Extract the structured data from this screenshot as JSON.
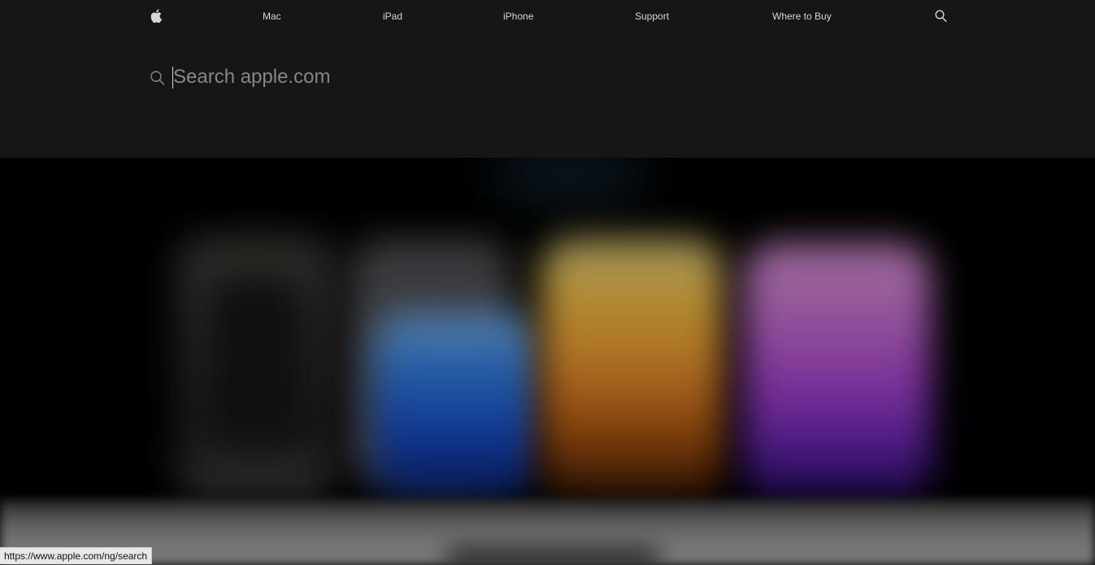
{
  "nav": {
    "apple_logo_icon": "apple-logo-icon",
    "items": [
      {
        "label": "Mac"
      },
      {
        "label": "iPad"
      },
      {
        "label": "iPhone"
      },
      {
        "label": "Support"
      },
      {
        "label": "Where to Buy"
      }
    ],
    "search_icon": "search-icon"
  },
  "search": {
    "placeholder": "Search apple.com",
    "value": ""
  },
  "status_bar": {
    "url": "https://www.apple.com/ng/search"
  },
  "colors": {
    "nav_background": "#161617",
    "nav_text": "#d6d6d6",
    "placeholder": "#86868b",
    "page_background": "#000000"
  }
}
